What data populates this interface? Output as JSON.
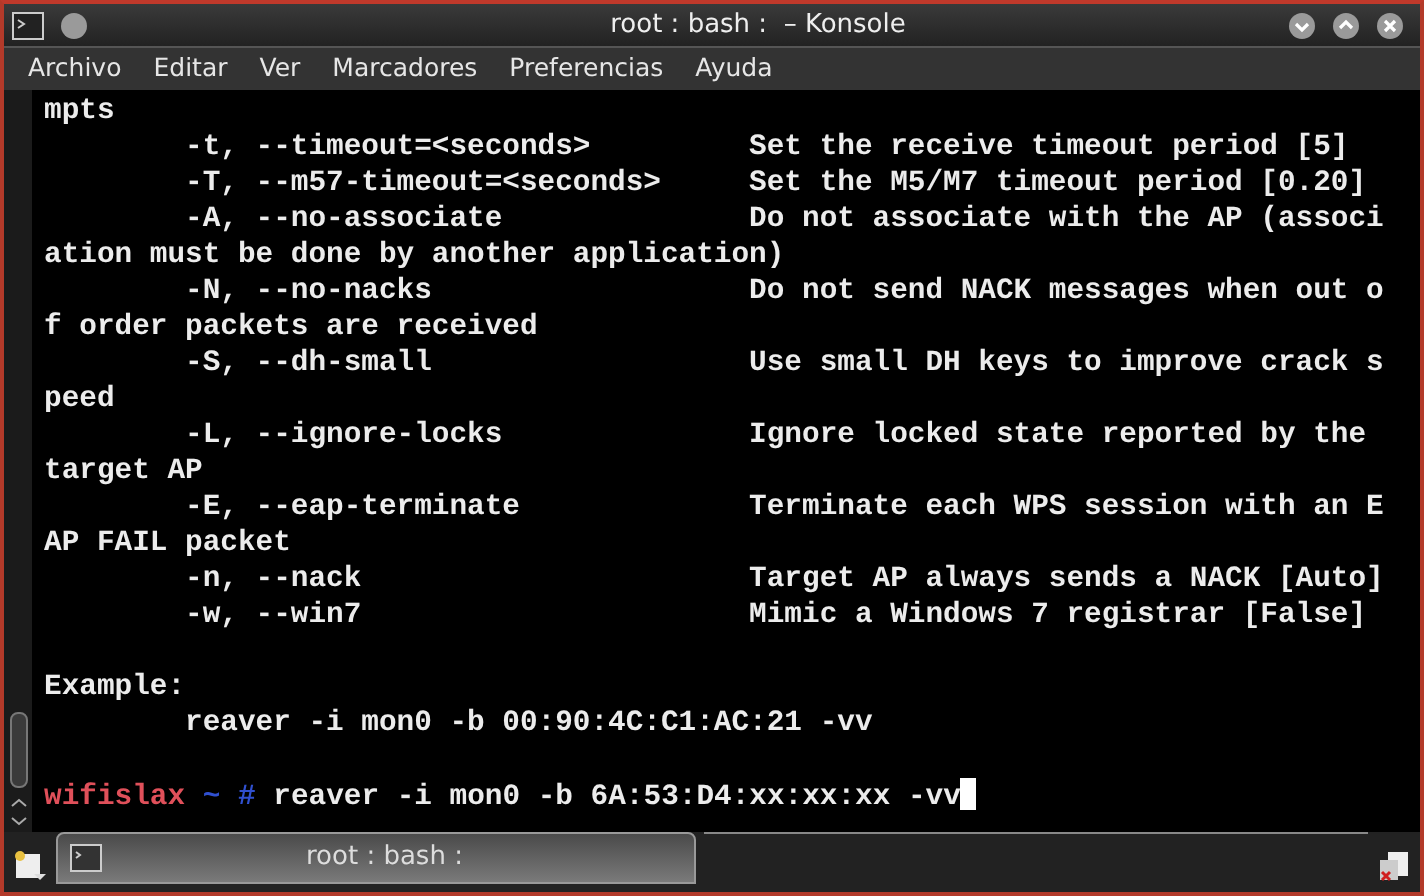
{
  "window": {
    "title": "root : bash :  – Konsole"
  },
  "menu": [
    "Archivo",
    "Editar",
    "Ver",
    "Marcadores",
    "Preferencias",
    "Ayuda"
  ],
  "terminal": {
    "lines": [
      {
        "kind": "text",
        "text": "mpts"
      },
      {
        "kind": "text",
        "text": "        -t, --timeout=<seconds>         Set the receive timeout period [5]"
      },
      {
        "kind": "text",
        "text": "        -T, --m57-timeout=<seconds>     Set the M5/M7 timeout period [0.20]"
      },
      {
        "kind": "text",
        "text": "        -A, --no-associate              Do not associate with the AP (associ"
      },
      {
        "kind": "text",
        "text": "ation must be done by another application)"
      },
      {
        "kind": "text",
        "text": "        -N, --no-nacks                  Do not send NACK messages when out o"
      },
      {
        "kind": "text",
        "text": "f order packets are received"
      },
      {
        "kind": "text",
        "text": "        -S, --dh-small                  Use small DH keys to improve crack s"
      },
      {
        "kind": "text",
        "text": "peed"
      },
      {
        "kind": "text",
        "text": "        -L, --ignore-locks              Ignore locked state reported by the"
      },
      {
        "kind": "text",
        "text": "target AP"
      },
      {
        "kind": "text",
        "text": "        -E, --eap-terminate             Terminate each WPS session with an E"
      },
      {
        "kind": "text",
        "text": "AP FAIL packet"
      },
      {
        "kind": "text",
        "text": "        -n, --nack                      Target AP always sends a NACK [Auto]"
      },
      {
        "kind": "text",
        "text": "        -w, --win7                      Mimic a Windows 7 registrar [False]"
      },
      {
        "kind": "blank"
      },
      {
        "kind": "text",
        "text": "Example:"
      },
      {
        "kind": "text",
        "text": "        reaver -i mon0 -b 00:90:4C:C1:AC:21 -vv"
      },
      {
        "kind": "blank"
      },
      {
        "kind": "prompt",
        "host": "wifislax",
        "dir": "~",
        "symbol": "#",
        "command": "reaver -i mon0 -b 6A:53:D4:xx:xx:xx -vv"
      }
    ]
  },
  "tabs": [
    {
      "label": "root : bash :",
      "selected": true
    }
  ]
}
